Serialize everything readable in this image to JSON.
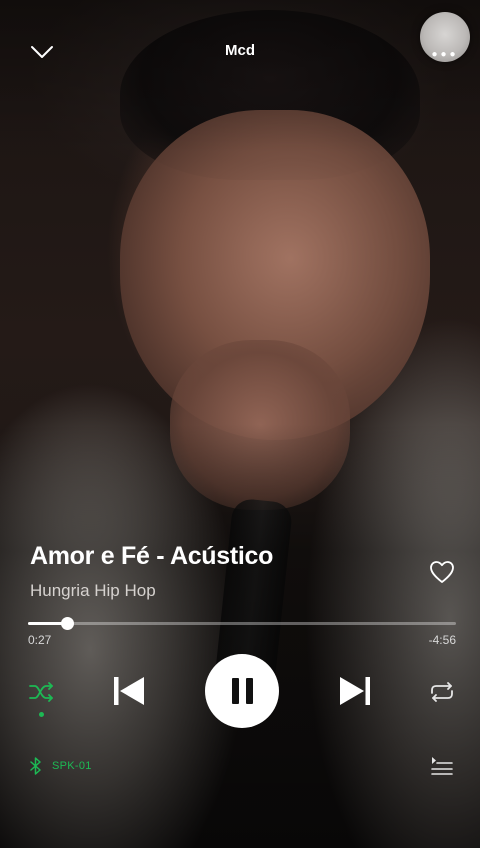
{
  "header": {
    "title": "Mcd"
  },
  "track": {
    "title": "Amor e Fé - Acústico",
    "artist": "Hungria Hip Hop"
  },
  "playback": {
    "elapsed": "0:27",
    "remaining": "-4:56",
    "progress_fraction": 0.09,
    "state": "playing",
    "shuffle_active": true
  },
  "device": {
    "name": "SPK-01"
  },
  "icons": {
    "collapse": "chevron-down-icon",
    "more": "more-dots-icon",
    "like": "heart-outline-icon",
    "shuffle": "shuffle-icon",
    "previous": "skip-previous-icon",
    "pause": "pause-icon",
    "next": "skip-next-icon",
    "repeat": "repeat-icon",
    "device": "bluetooth-icon",
    "queue": "queue-icon"
  },
  "colors": {
    "accent": "#1db954",
    "text": "#ffffff",
    "secondary_text": "#d6d2cf"
  }
}
